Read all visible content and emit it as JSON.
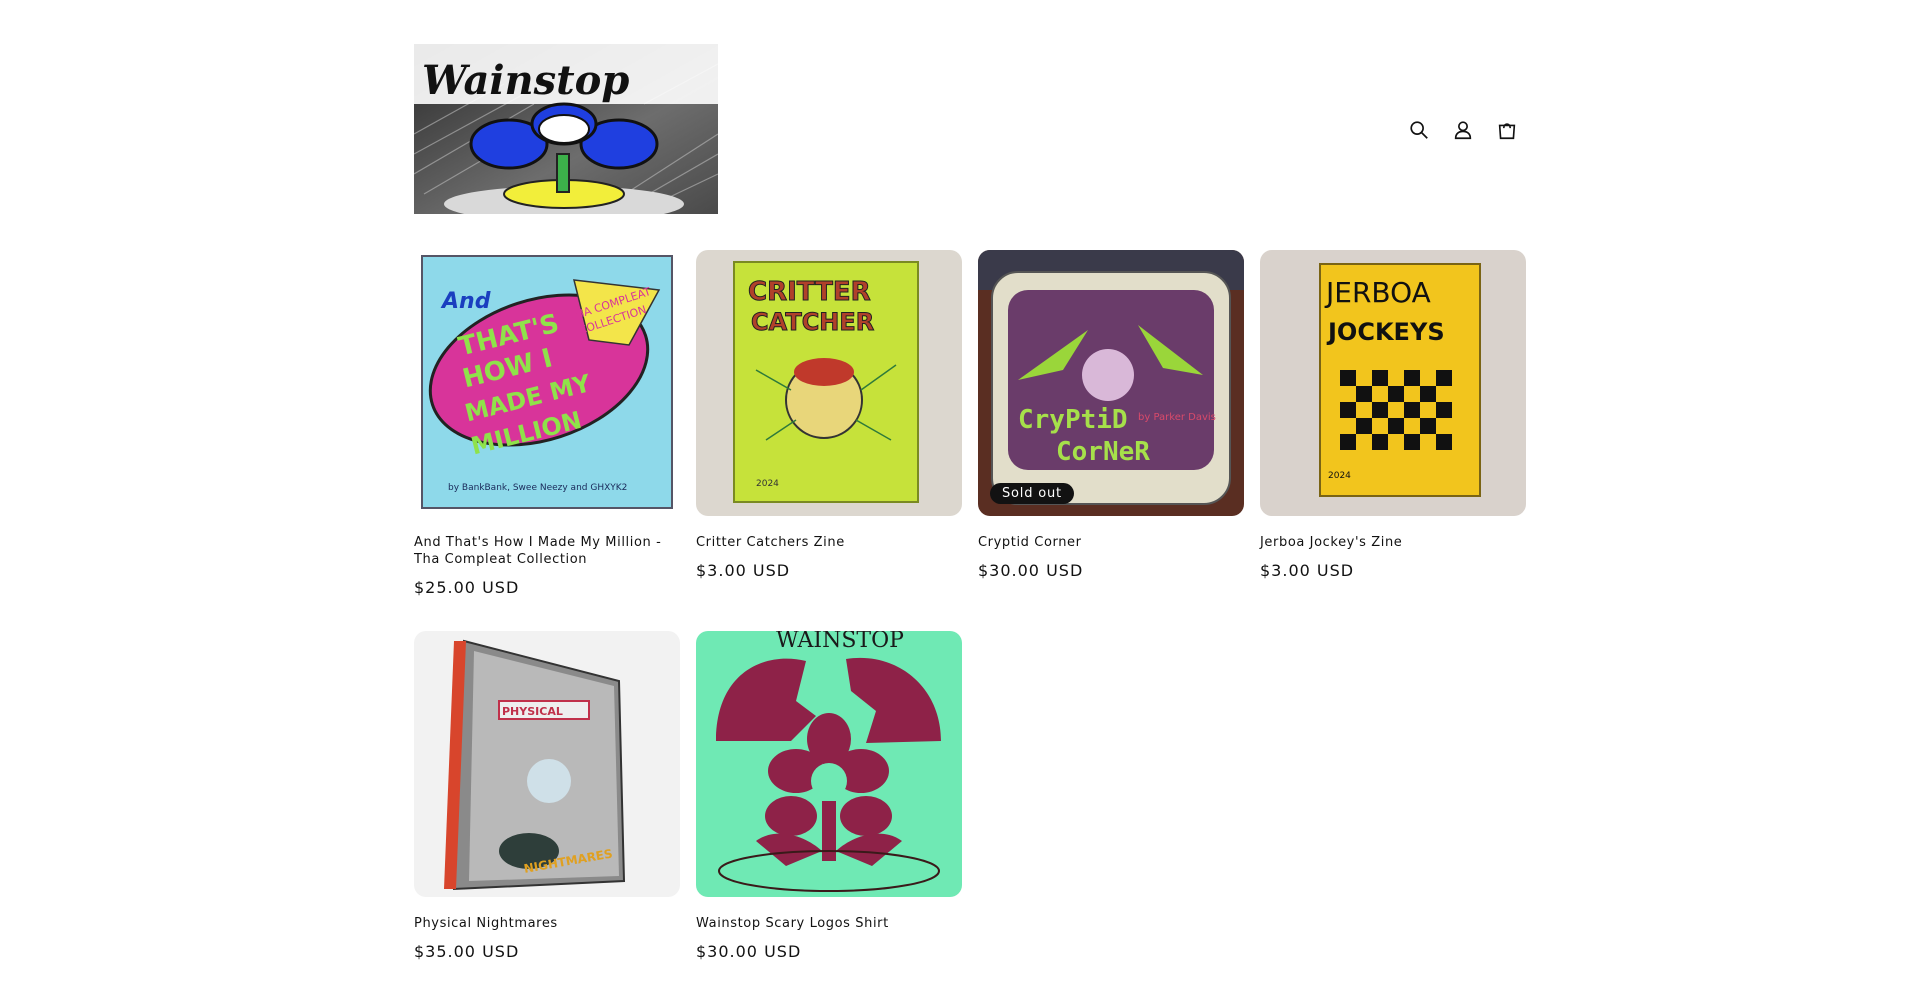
{
  "header": {
    "logo_text": "Wainstop",
    "icons": {
      "search": "search-icon",
      "account": "account-icon",
      "cart": "cart-icon"
    }
  },
  "products": [
    {
      "title": "And That's How I Made My Million - Tha Compleat Collection",
      "price": "$25.00 USD",
      "cover_text": [
        "And",
        "THAT'S",
        "HOW I",
        "MADE MY",
        "MILLION",
        "THA COMPLEAT",
        "COLLECTION",
        "by BankBank, Swee Neezy and GHXYK2"
      ]
    },
    {
      "title": "Critter Catchers Zine",
      "price": "$3.00 USD",
      "cover_text": [
        "CRITTER",
        "CATCHER",
        "2024"
      ]
    },
    {
      "title": "Cryptid Corner",
      "price": "$30.00 USD",
      "badge": "Sold out",
      "cover_text": [
        "CryPtiD",
        "CorNeR",
        "by Parker Davis"
      ]
    },
    {
      "title": "Jerboa Jockey's Zine",
      "price": "$3.00 USD",
      "cover_text": [
        "JERBOA",
        "JOCKEYS",
        "2024"
      ]
    },
    {
      "title": "Physical Nightmares",
      "price": "$35.00 USD",
      "cover_text": [
        "PHYSICAL",
        "NIGHTMARES"
      ]
    },
    {
      "title": "Wainstop Scary Logos Shirt",
      "price": "$30.00 USD",
      "cover_text": [
        "WAINSTOP"
      ]
    }
  ],
  "colors": {
    "text": "#121212",
    "badge_bg": "#121212",
    "badge_text": "#ffffff",
    "background": "#ffffff"
  }
}
